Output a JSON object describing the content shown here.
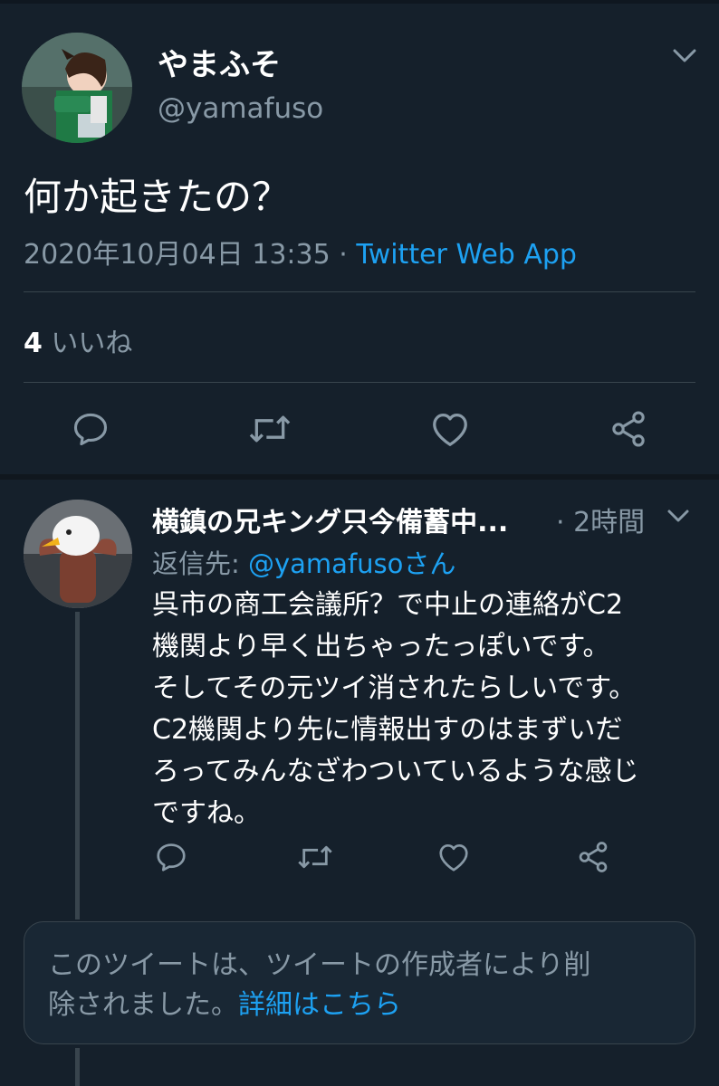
{
  "main_tweet": {
    "display_name": "やまふそ",
    "handle": "@yamafuso",
    "text": "何か起きたの？",
    "timestamp": "2020年10月04日 13:35",
    "separator": "·",
    "source": "Twitter Web App",
    "like_count": "4",
    "like_label": "いいね"
  },
  "reply": {
    "display_name": "横鎮の兄キング只今備蓄中...",
    "time_ago": "· 2時間",
    "reply_to_label": "返信先:",
    "reply_to_mention": "@yamafusoさん",
    "lines": [
      "呉市の商工会議所？で中止の連絡がC2",
      "機関より早く出ちゃったっぽいです。",
      "そしてその元ツイ消されたらしいです。",
      "C2機関より先に情報出すのはまずいだ",
      "ろってみんなざわついているような感じ",
      "ですね。"
    ]
  },
  "deleted_notice": {
    "line1": "このツイートは、ツイートの作成者により削",
    "line2_prefix": "除されました。",
    "link_text": "詳細はこちら"
  },
  "icons": {
    "reply": "comment-icon",
    "retweet": "retweet-icon",
    "like": "heart-icon",
    "share": "share-icon",
    "more": "chevron-down-icon"
  },
  "colors": {
    "background": "#15202b",
    "accent": "#1da1f2",
    "secondary_text": "#8899a6",
    "divider": "#38444d"
  }
}
